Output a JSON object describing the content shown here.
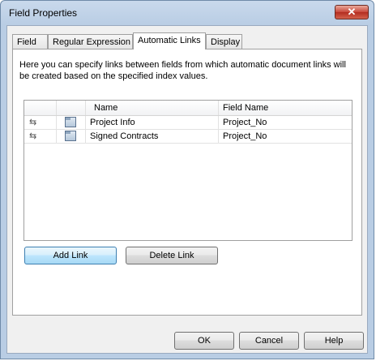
{
  "window": {
    "title": "Field Properties",
    "close_symbol": "✕"
  },
  "tabs": [
    {
      "label": "Field"
    },
    {
      "label": "Regular Expression"
    },
    {
      "label": "Automatic Links"
    },
    {
      "label": "Display"
    }
  ],
  "active_tab": "Automatic Links",
  "panel": {
    "description": "Here you can specify links between fields from which automatic document links will be created based on the specified index values."
  },
  "grid": {
    "columns": [
      "",
      "",
      "Name",
      "Field Name"
    ],
    "rows": [
      {
        "link_icon": "⇆",
        "icon": "document-icon",
        "name": "Project Info",
        "field_name": "Project_No"
      },
      {
        "link_icon": "⇆",
        "icon": "document-icon",
        "name": "Signed Contracts",
        "field_name": "Project_No"
      }
    ]
  },
  "panel_buttons": {
    "add_label": "Add Link",
    "delete_label": "Delete Link"
  },
  "footer_buttons": {
    "ok_label": "OK",
    "cancel_label": "Cancel",
    "help_label": "Help"
  }
}
